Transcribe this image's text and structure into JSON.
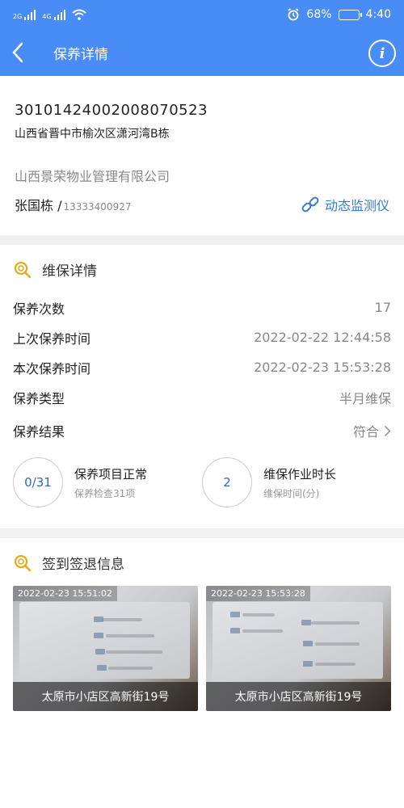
{
  "status_bar": {
    "network_1": "2G",
    "network_2": "4G",
    "battery": "68%",
    "battery_level": 0.68,
    "time": "4:40",
    "icons": [
      "signal-icon",
      "wifi-icon",
      "alarm-icon",
      "battery-icon"
    ]
  },
  "nav": {
    "title": "保养详情",
    "info_glyph": "i"
  },
  "elevator": {
    "device_no": "30101424002008070523",
    "address": "山西省晋中市榆次区潇河湾B栋",
    "company": "山西景荣物业管理有限公司",
    "contact_name": "张国栋 /",
    "contact_phone": "13333400927",
    "monitor_link": "动态监测仪"
  },
  "maintenance": {
    "section_title": "维保详情",
    "rows": [
      {
        "label": "保养次数",
        "value": "17"
      },
      {
        "label": "上次保养时间",
        "value": "2022-02-22 12:44:58"
      },
      {
        "label": "本次保养时间",
        "value": "2022-02-23 15:53:28"
      },
      {
        "label": "保养类型",
        "value": "半月维保"
      }
    ],
    "result_label": "保养结果",
    "result_value": "符合",
    "stats": [
      {
        "circle": "0/31",
        "title": "保养项目正常",
        "sub": "保养检查31项"
      },
      {
        "circle": "2",
        "title": "维保作业时长",
        "sub": "维保时间(分)"
      }
    ]
  },
  "checkin": {
    "section_title": "签到签退信息",
    "photos": [
      {
        "timestamp": "2022-02-23 15:51:02",
        "location": "太原市小店区高新街19号"
      },
      {
        "timestamp": "2022-02-23 15:53:28",
        "location": "太原市小店区高新街19号"
      }
    ]
  },
  "colors": {
    "header_blue": "#4a8cf5",
    "link_blue": "#3a7bd5",
    "accent_gold": "#e8a91c"
  }
}
